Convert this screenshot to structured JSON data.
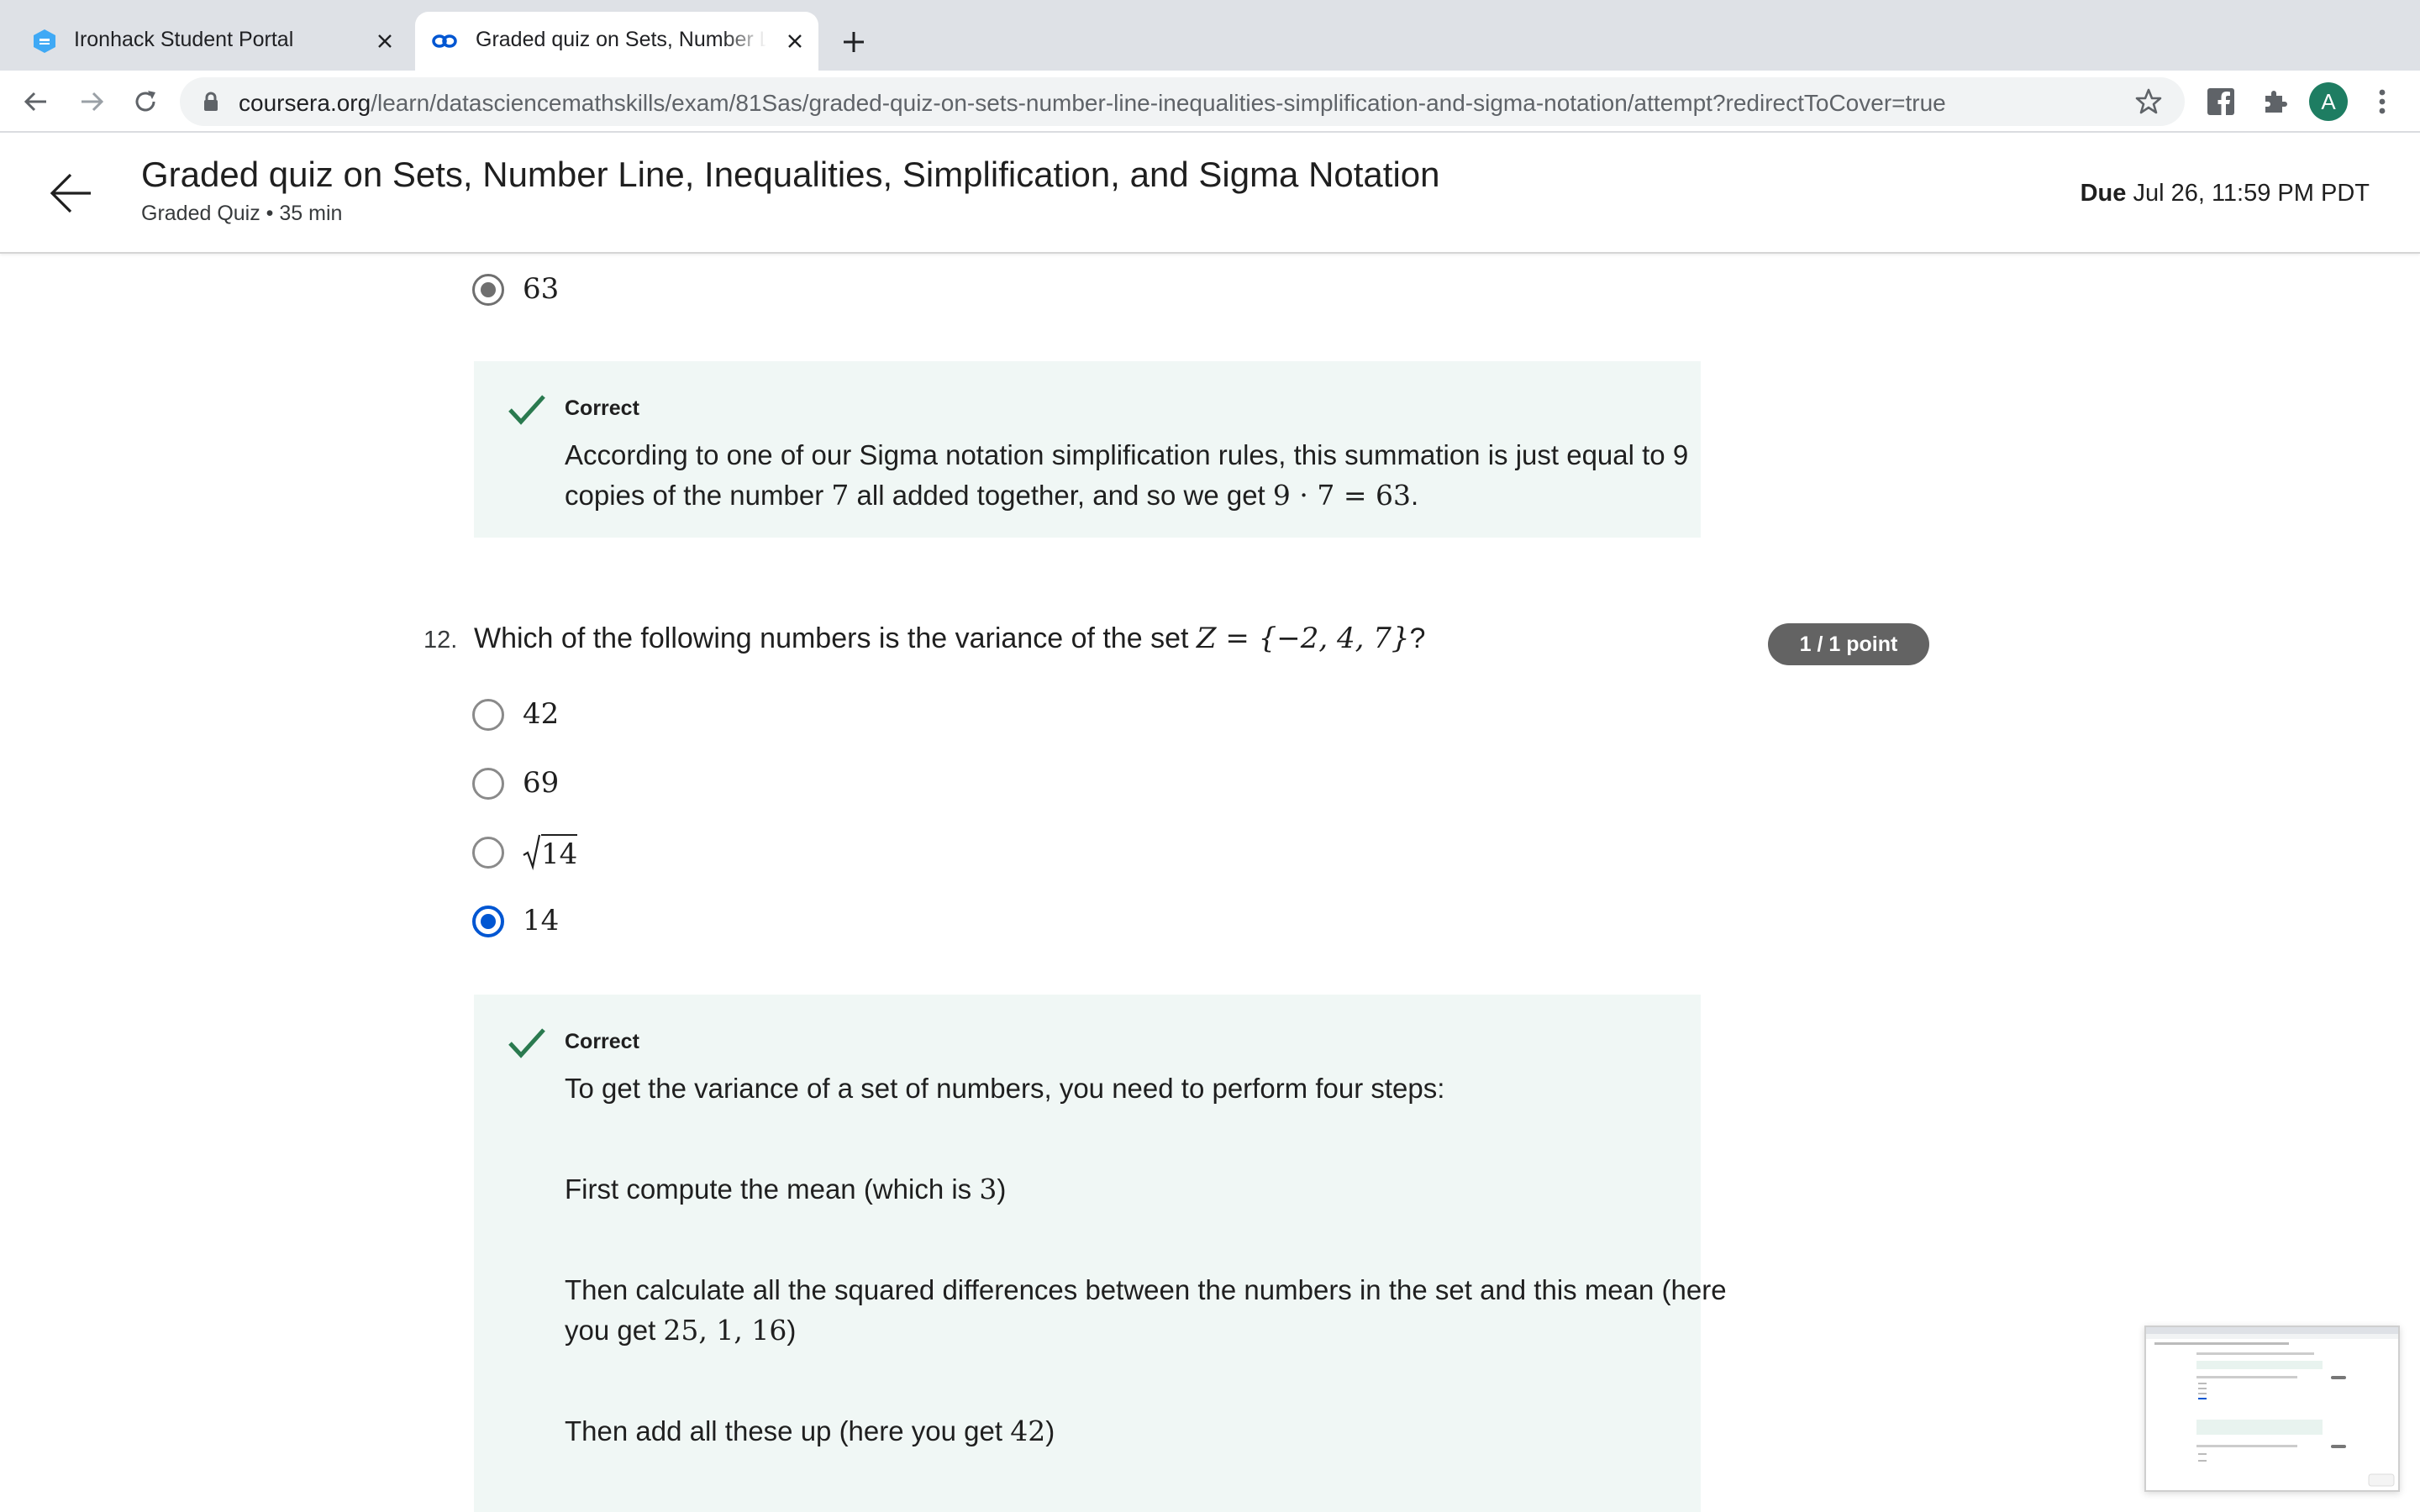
{
  "browser": {
    "tabs": [
      {
        "title": "Ironhack Student Portal",
        "active": false
      },
      {
        "title": "Graded quiz on Sets, Number Line",
        "active": true
      }
    ],
    "url_host": "coursera.org",
    "url_path": "/learn/datasciencemathskills/exam/81Sas/graded-quiz-on-sets-number-line-inequalities-simplification-and-sigma-notation/attempt?redirectToCover=true",
    "profile_initial": "A",
    "profile_color": "#1e7d62"
  },
  "header": {
    "title": "Graded quiz on Sets, Number Line, Inequalities, Simplification, and Sigma Notation",
    "meta": "Graded Quiz • 35 min",
    "due_label": "Due",
    "due_value": "Jul 26, 11:59 PM PDT"
  },
  "q11": {
    "selected_option": "63",
    "feedback_title": "Correct",
    "feedback_line1": "According to one of our Sigma notation simplification rules, this summation is just equal to 9",
    "feedback_line2_a": "copies of the number ",
    "feedback_line2_b": "7",
    "feedback_line2_c": " all added together, and so we get ",
    "feedback_line2_math": "9 · 7 = 63",
    "feedback_line2_d": "."
  },
  "q12": {
    "number": "12.",
    "question_prefix": "Which of the following numbers is the variance of the set ",
    "question_math": "Z = {−2, 4, 7}",
    "question_suffix": "?",
    "score": "1 / 1 point",
    "options": [
      "42",
      "69",
      "14",
      "14"
    ],
    "selected_index": 3,
    "feedback_title": "Correct",
    "feedback_intro": "To get the variance of a set of numbers, you need to perform four steps:",
    "step1_text": "First compute the mean (which is ",
    "step1_math": "3",
    "step1_end": ")",
    "step2_line1": "Then calculate all the squared differences between the numbers in the set and this mean (here",
    "step2_line2_text": "you get ",
    "step2_line2_math": "25, 1, 16",
    "step2_line2_end": ")",
    "step3_text": "Then add all these up (here you get ",
    "step3_math": "42",
    "step3_end": ")"
  },
  "colors": {
    "accent_blue": "#0056d2",
    "correct_green": "#2a7a4f",
    "feedback_bg": "#f0f7f5",
    "badge_gray": "#636363"
  }
}
